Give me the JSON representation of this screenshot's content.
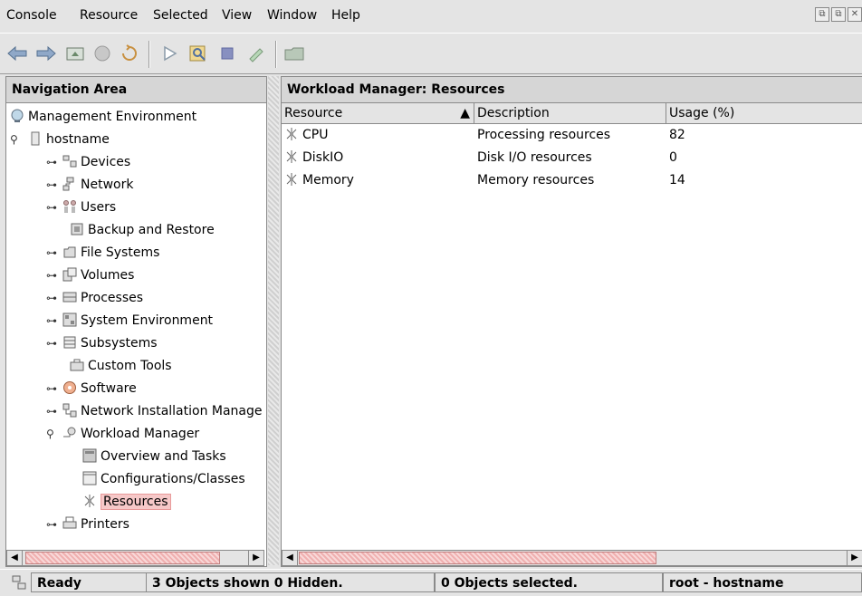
{
  "menu": {
    "items": [
      "Console",
      "Resource",
      "Selected",
      "View",
      "Window",
      "Help"
    ]
  },
  "toolbar": {
    "buttons": [
      "back-arrow-icon",
      "forward-arrow-icon",
      "up-folder-icon",
      "stop-icon",
      "refresh-icon",
      "run-icon",
      "find-icon",
      "stop-square-icon",
      "pencil-icon",
      "folder-icon"
    ]
  },
  "nav": {
    "title": "Navigation Area",
    "items": [
      {
        "label": "Management Environment"
      },
      {
        "label": "hostname"
      },
      {
        "label": "Devices"
      },
      {
        "label": "Network"
      },
      {
        "label": "Users"
      },
      {
        "label": "Backup and Restore"
      },
      {
        "label": "File Systems"
      },
      {
        "label": "Volumes"
      },
      {
        "label": "Processes"
      },
      {
        "label": "System Environment"
      },
      {
        "label": "Subsystems"
      },
      {
        "label": "Custom Tools"
      },
      {
        "label": "Software"
      },
      {
        "label": "Network Installation Manage"
      },
      {
        "label": "Workload Manager"
      },
      {
        "label": "Overview and Tasks"
      },
      {
        "label": "Configurations/Classes"
      },
      {
        "label": "Resources"
      },
      {
        "label": "Printers"
      }
    ]
  },
  "main": {
    "title": "Workload Manager: Resources",
    "columns": [
      "Resource",
      "Description",
      "Usage (%)"
    ],
    "sort_indicator": "▲",
    "rows": [
      {
        "resource": "CPU",
        "description": "Processing resources",
        "usage": "82"
      },
      {
        "resource": "DiskIO",
        "description": "Disk I/O resources",
        "usage": "0"
      },
      {
        "resource": "Memory",
        "description": "Memory resources",
        "usage": "14"
      }
    ]
  },
  "status": {
    "ready": "Ready",
    "objects_shown": "3 Objects shown 0 Hidden.",
    "objects_selected": "0 Objects selected.",
    "user": "root - hostname"
  },
  "colors": {
    "selection": "#f6c8c8",
    "background": "#e4e4e4"
  }
}
